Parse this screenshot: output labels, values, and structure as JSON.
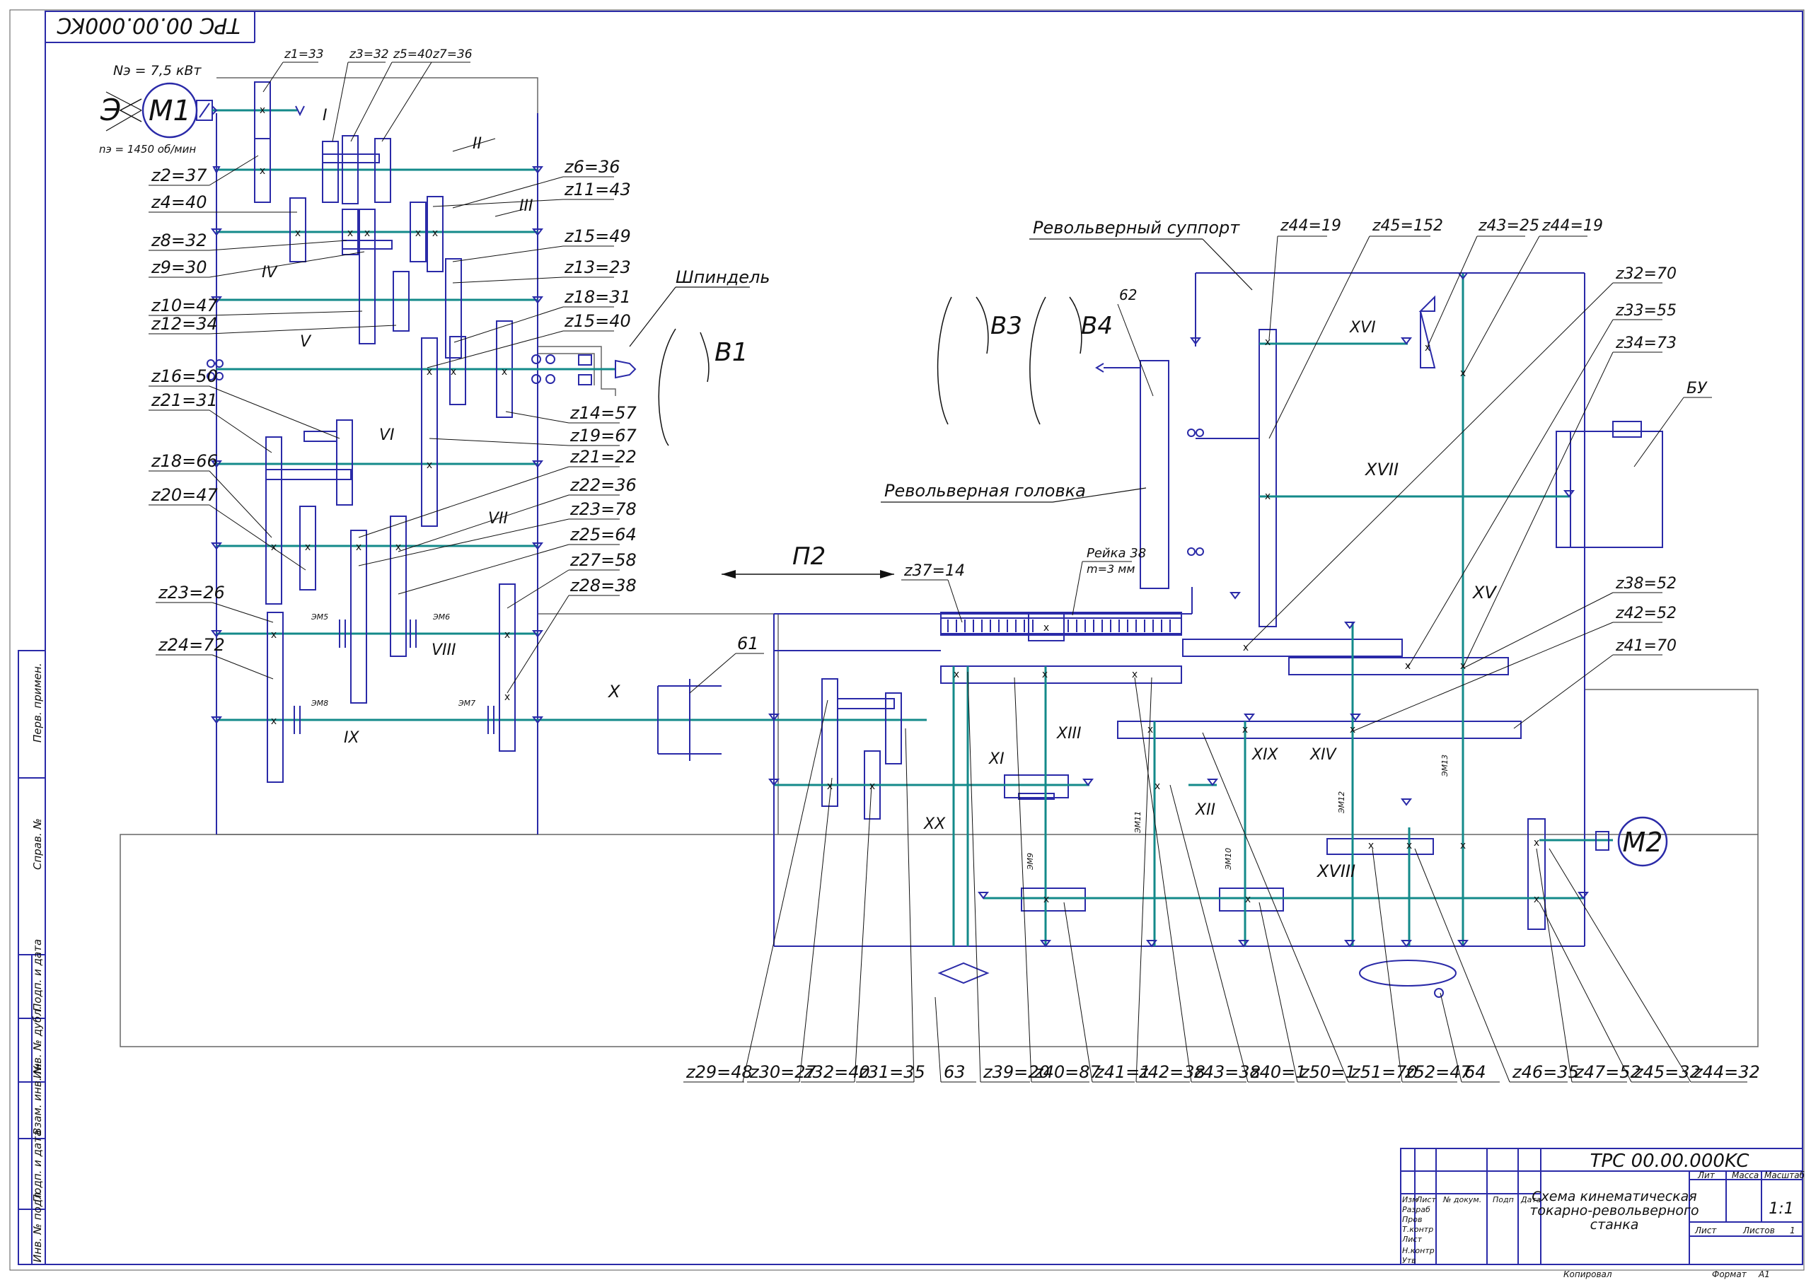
{
  "drawing_code_mirrored": "TPC 00.00.000KC",
  "motor1": {
    "name": "M1",
    "power": "Nэ = 7,5 кВт",
    "speed": "nэ = 1450 об/мин",
    "e_label": "Э"
  },
  "motor2": {
    "name": "M2"
  },
  "spindle_label": "Шпиндель",
  "turret_support_label": "Револьверный суппорт",
  "turret_head_label": "Револьверная головка",
  "rack_label": "Рейка 38",
  "rack_module": "m=3 мм",
  "bu_label": "БУ",
  "motions": {
    "b1": "B1",
    "b3": "B3",
    "b4": "B4",
    "p2": "П2"
  },
  "refs": {
    "r61": "61",
    "r62": "62",
    "r63": "63",
    "r64": "64"
  },
  "shafts": {
    "s2": "II",
    "s3": "III",
    "s4": "IV",
    "s5": "V",
    "s6": "VI",
    "s7": "VII",
    "s8": "VIII",
    "s9": "IX",
    "s10": "X",
    "s11": "XI",
    "s12": "XII",
    "s13": "XIII",
    "s14": "XIV",
    "s15": "XV",
    "s16": "XVI",
    "s17": "XVII",
    "s18": "XVIII",
    "s19": "XIX",
    "s20": "XX"
  },
  "clutches": {
    "em5": "ЭМ5",
    "em6": "ЭМ6",
    "em7": "ЭМ7",
    "em8": "ЭМ8",
    "em9": "ЭМ9",
    "em10": "ЭМ10",
    "em11": "ЭМ11",
    "em12": "ЭМ12",
    "em13": "ЭМ13"
  },
  "gears_left": {
    "top1": "z1=33",
    "top2": "z3=32",
    "top3": "z5=40",
    "top4": "z7=36",
    "l1": "z2=37",
    "l2": "z4=40",
    "l3": "z8=32",
    "l4": "z9=30",
    "l5": "z10=47",
    "l6": "z12=34",
    "l7": "z16=50",
    "l8": "z21=31",
    "l9": "z18=66",
    "l10": "z20=47",
    "l11": "z23=26",
    "l12": "z24=72",
    "r1": "z6=36",
    "r2": "z11=43",
    "r3": "z15=49",
    "r4": "z13=23",
    "r5": "z18=31",
    "r6": "z15=40",
    "r7": "z14=57",
    "r8": "z19=67",
    "r9": "z21=22",
    "r10": "z22=36",
    "r11": "z23=78",
    "r12": "z25=64",
    "r13": "z27=58",
    "r14": "z28=38"
  },
  "gears_right": {
    "g1": "z44=19",
    "g2": "z45=152",
    "g3": "z43=25",
    "g4": "z44=19",
    "g5": "z32=70",
    "g6": "z33=55",
    "g7": "z34=73",
    "g8": "z37=14",
    "g9": "z38=52",
    "g10": "z42=52",
    "g11": "z41=70"
  },
  "bottom_labels": [
    "z29=48",
    "z30=27",
    "z32=40",
    "z31=35",
    "63",
    "z39=20",
    "z40=87",
    "z41=1",
    "z42=38",
    "z43=38",
    "z40=1",
    "z50=1",
    "z51=70",
    "z52=47",
    "64",
    "z46=35",
    "z47=52",
    "z45=32",
    "z44=32"
  ],
  "title_block": {
    "code": "TPC 00.00.000KC",
    "title_l1": "Схема кинематическая",
    "title_l2": "токарно-револьверного",
    "title_l3": "станка",
    "h_izm": "Изм",
    "h_list": "Лист",
    "h_doc": "№ докум.",
    "h_sign": "Подп",
    "h_date": "Дата",
    "r_razrab": "Разраб",
    "r_prov": "Пров",
    "r_tkontr": "Т.контр",
    "r_list": "Лист",
    "r_nkontr": "Н.контр",
    "r_utv": "Утв",
    "lit": "Лит",
    "massa": "Масса",
    "masshtab": "Масштаб",
    "scale_value": "1:1",
    "sheet_label": "Лист",
    "sheets_label": "Листов",
    "sheets_value": "1",
    "copied": "Копировал",
    "format": "Формат",
    "format_value": "A1"
  },
  "side_stamps": [
    "Перв. примен.",
    "Справ. №",
    "Подп. и дата",
    "Инв. № дубл.",
    "Взам. инв. №",
    "Подп. и дата",
    "Инв. № подл."
  ]
}
